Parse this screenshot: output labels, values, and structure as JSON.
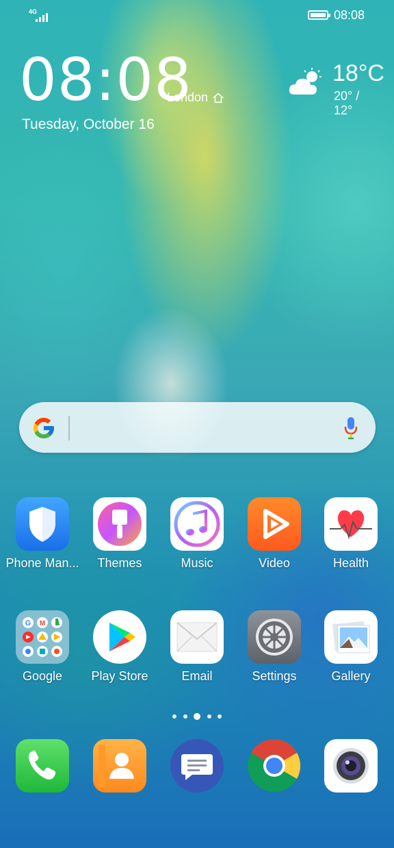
{
  "status_bar": {
    "network": "4G",
    "time": "08:08",
    "battery_level": 1.0
  },
  "clock_widget": {
    "time": "08:08",
    "city": "London",
    "date": "Tuesday, October 16",
    "temperature": "18°C",
    "range": "20° / 12°",
    "weather_icon": "partly-cloudy-icon"
  },
  "search": {
    "logo": "google-g-logo",
    "mic_icon": "microphone-icon"
  },
  "apps_row1": [
    {
      "label": "Phone Man...",
      "icon": "shield-icon"
    },
    {
      "label": "Themes",
      "icon": "paintbrush-icon"
    },
    {
      "label": "Music",
      "icon": "music-note-icon"
    },
    {
      "label": "Video",
      "icon": "play-icon"
    },
    {
      "label": "Health",
      "icon": "heart-pulse-icon"
    }
  ],
  "apps_row2": [
    {
      "label": "Google",
      "icon": "folder-icon"
    },
    {
      "label": "Play Store",
      "icon": "play-store-icon"
    },
    {
      "label": "Email",
      "icon": "envelope-icon"
    },
    {
      "label": "Settings",
      "icon": "gear-icon"
    },
    {
      "label": "Gallery",
      "icon": "photo-icon"
    }
  ],
  "page_indicator": {
    "count": 5,
    "active": 3
  },
  "dock": [
    {
      "name": "phone",
      "icon": "phone-handset-icon"
    },
    {
      "name": "contacts",
      "icon": "contact-person-icon"
    },
    {
      "name": "messages",
      "icon": "chat-bubble-icon"
    },
    {
      "name": "chrome",
      "icon": "chrome-icon"
    },
    {
      "name": "camera",
      "icon": "camera-lens-icon"
    }
  ]
}
